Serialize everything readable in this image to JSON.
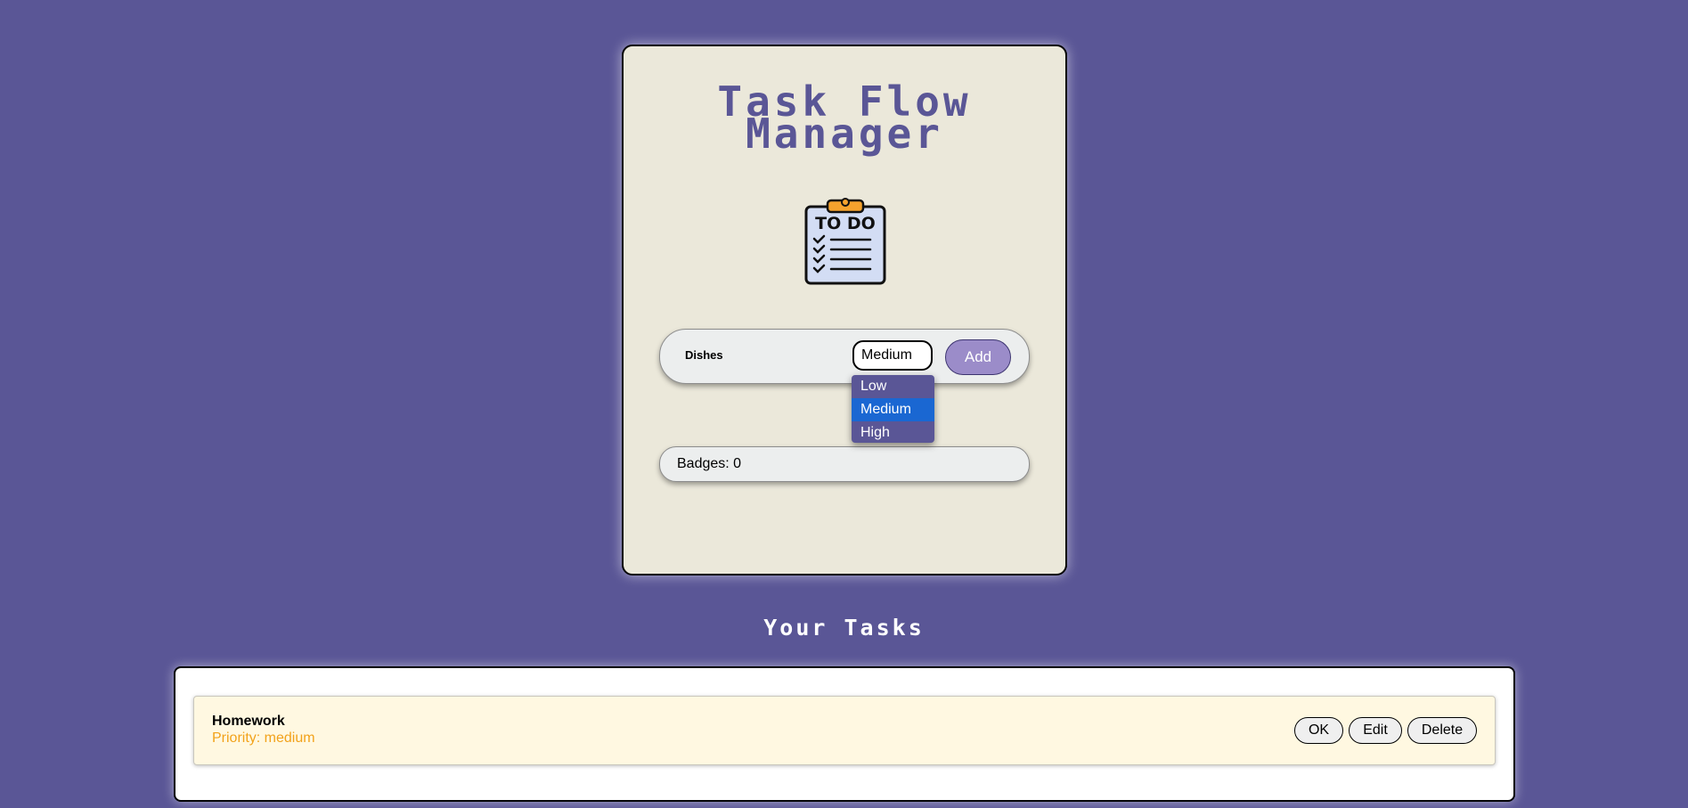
{
  "app": {
    "title_line1": "Task Flow",
    "title_line2": "Manager",
    "logo_icon": "todo-clipboard-icon",
    "logo_text": "TO DO"
  },
  "add_form": {
    "task_value": "Dishes",
    "priority_selected": "Medium",
    "add_label": "Add"
  },
  "priority_dropdown": {
    "options": [
      "Low",
      "Medium",
      "High"
    ],
    "highlighted": "Medium"
  },
  "badges": {
    "text": "Badges: 0"
  },
  "tasks_section": {
    "heading": "Your Tasks",
    "tasks": [
      {
        "name": "Homework",
        "priority_text": "Priority: medium",
        "ok_label": "OK",
        "edit_label": "Edit",
        "delete_label": "Delete"
      }
    ]
  },
  "colors": {
    "background": "#5a5696",
    "card": "#ebe8da",
    "accent_button": "#9b8cc9",
    "priority_medium": "#f2a21a",
    "option_highlight": "#1a67d2",
    "task_row": "#fff8e1"
  }
}
